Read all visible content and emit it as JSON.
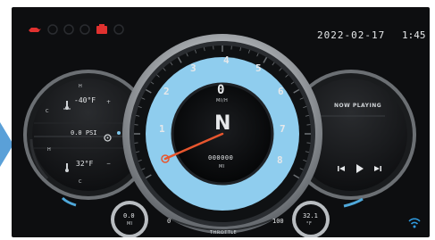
{
  "status_bar": {
    "date": "2022-02-17",
    "time": "1:45",
    "warning_icons": [
      {
        "name": "oil-pressure-icon",
        "color": "#e0312f"
      },
      {
        "name": "tire-pressure-icon",
        "color": "#2a2c30"
      },
      {
        "name": "traction-icon",
        "color": "#2a2c30"
      },
      {
        "name": "abs-icon",
        "color": "#2a2c30"
      },
      {
        "name": "engine-check-icon",
        "color": "#e0312f"
      },
      {
        "name": "gear-warning-icon",
        "color": "#2a2c30"
      }
    ]
  },
  "left_gauge": {
    "top_mark_h": "H",
    "top_mark_c": "C",
    "outside_temp": "-40°F",
    "pressure": "0.0 PSI",
    "bottom_mark_h": "H",
    "bottom_mark_c": "C",
    "engine_temp": "32°F"
  },
  "speedometer": {
    "ticks": [
      "1",
      "2",
      "3",
      "4",
      "5",
      "6",
      "7",
      "8"
    ],
    "speed_value": "0",
    "speed_unit": "MI/H",
    "gear": "N",
    "odometer": "000000",
    "odometer_unit": "MI",
    "throttle_label": "THROTTLE",
    "throttle_min": "0",
    "throttle_max": "100"
  },
  "right_gauge": {
    "now_playing": "NOW PLAYING"
  },
  "bottom": {
    "trip_value": "0.0",
    "trip_unit": "MI",
    "ambient_value": "32.1",
    "ambient_unit": "°F"
  },
  "colors": {
    "accent": "#7ec5ea",
    "warning": "#e0312f",
    "needle": "#e8562e",
    "wifi": "#2f9be0"
  }
}
